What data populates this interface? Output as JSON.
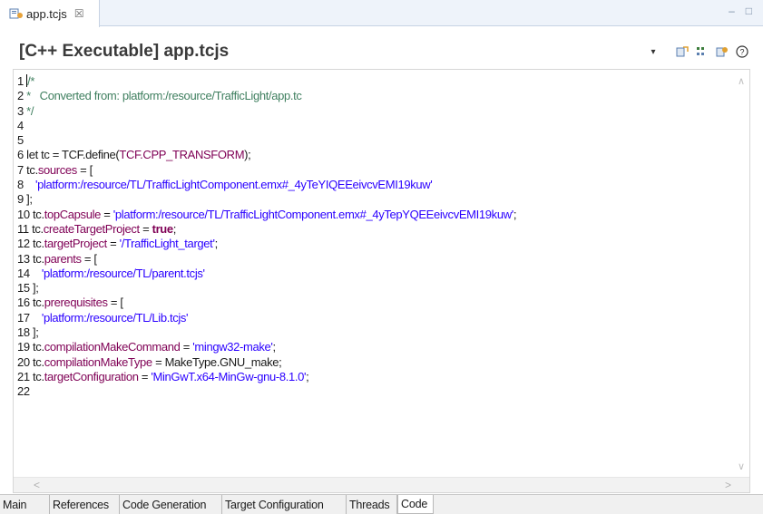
{
  "editor_tab": {
    "title": "app.tcjs",
    "close": "☒"
  },
  "window_controls": {
    "minimize": "–",
    "maximize": "□"
  },
  "header": {
    "title": "[C++ Executable] app.tcjs"
  },
  "toolbar": {
    "menu": "▾",
    "help": "?"
  },
  "code_lines": [
    [
      {
        "t": "ln",
        "v": "1 "
      },
      {
        "t": "cursor",
        "v": ""
      },
      {
        "t": "cm",
        "v": "/*"
      }
    ],
    [
      {
        "t": "ln",
        "v": "2 "
      },
      {
        "t": "cm",
        "v": "*   Converted from: platform:/resource/TrafficLight/app.tc"
      }
    ],
    [
      {
        "t": "ln",
        "v": "3 "
      },
      {
        "t": "cm",
        "v": "*/"
      }
    ],
    [
      {
        "t": "ln",
        "v": "4"
      }
    ],
    [
      {
        "t": "ln",
        "v": "5"
      }
    ],
    [
      {
        "t": "ln",
        "v": "6 "
      },
      {
        "t": "p",
        "v": "let tc = TCF.define("
      },
      {
        "t": "pr",
        "v": "TCF.CPP_TRANSFORM"
      },
      {
        "t": "p",
        "v": ");"
      }
    ],
    [
      {
        "t": "ln",
        "v": "7 "
      },
      {
        "t": "p",
        "v": "tc."
      },
      {
        "t": "pr",
        "v": "sources"
      },
      {
        "t": "p",
        "v": " = ["
      }
    ],
    [
      {
        "t": "ln",
        "v": "8    "
      },
      {
        "t": "st",
        "v": "'platform:/resource/TL/TrafficLightComponent.emx#_4yTeYIQEEeivcvEMI19kuw'"
      }
    ],
    [
      {
        "t": "ln",
        "v": "9 "
      },
      {
        "t": "p",
        "v": "];"
      }
    ],
    [
      {
        "t": "ln",
        "v": "10 "
      },
      {
        "t": "p",
        "v": "tc."
      },
      {
        "t": "pr",
        "v": "topCapsule"
      },
      {
        "t": "p",
        "v": " = "
      },
      {
        "t": "st",
        "v": "'platform:/resource/TL/TrafficLightComponent.emx#_4yTepYQEEeivcvEMI19kuw'"
      },
      {
        "t": "p",
        "v": ";"
      }
    ],
    [
      {
        "t": "ln",
        "v": "11 "
      },
      {
        "t": "p",
        "v": "tc."
      },
      {
        "t": "pr",
        "v": "createTargetProject"
      },
      {
        "t": "p",
        "v": " = "
      },
      {
        "t": "kw",
        "v": "true"
      },
      {
        "t": "p",
        "v": ";"
      }
    ],
    [
      {
        "t": "ln",
        "v": "12 "
      },
      {
        "t": "p",
        "v": "tc."
      },
      {
        "t": "pr",
        "v": "targetProject"
      },
      {
        "t": "p",
        "v": " = "
      },
      {
        "t": "st",
        "v": "'/TrafficLight_target'"
      },
      {
        "t": "p",
        "v": ";"
      }
    ],
    [
      {
        "t": "ln",
        "v": "13 "
      },
      {
        "t": "p",
        "v": "tc."
      },
      {
        "t": "pr",
        "v": "parents"
      },
      {
        "t": "p",
        "v": " = ["
      }
    ],
    [
      {
        "t": "ln",
        "v": "14    "
      },
      {
        "t": "st",
        "v": "'platform:/resource/TL/parent.tcjs'"
      }
    ],
    [
      {
        "t": "ln",
        "v": "15 "
      },
      {
        "t": "p",
        "v": "];"
      }
    ],
    [
      {
        "t": "ln",
        "v": "16 "
      },
      {
        "t": "p",
        "v": "tc."
      },
      {
        "t": "pr",
        "v": "prerequisites"
      },
      {
        "t": "p",
        "v": " = ["
      }
    ],
    [
      {
        "t": "ln",
        "v": "17    "
      },
      {
        "t": "st",
        "v": "'platform:/resource/TL/Lib.tcjs'"
      }
    ],
    [
      {
        "t": "ln",
        "v": "18 "
      },
      {
        "t": "p",
        "v": "];"
      }
    ],
    [
      {
        "t": "ln",
        "v": "19 "
      },
      {
        "t": "p",
        "v": "tc."
      },
      {
        "t": "pr",
        "v": "compilationMakeCommand"
      },
      {
        "t": "p",
        "v": " = "
      },
      {
        "t": "st",
        "v": "'mingw32-make'"
      },
      {
        "t": "p",
        "v": ";"
      }
    ],
    [
      {
        "t": "ln",
        "v": "20 "
      },
      {
        "t": "p",
        "v": "tc."
      },
      {
        "t": "pr",
        "v": "compilationMakeType"
      },
      {
        "t": "p",
        "v": " = MakeType.GNU_make;"
      }
    ],
    [
      {
        "t": "ln",
        "v": "21 "
      },
      {
        "t": "p",
        "v": "tc."
      },
      {
        "t": "pr",
        "v": "targetConfiguration"
      },
      {
        "t": "p",
        "v": " = "
      },
      {
        "t": "st",
        "v": "'MinGwT.x64-MinGw-gnu-8.1.0'"
      },
      {
        "t": "p",
        "v": ";"
      }
    ],
    [
      {
        "t": "ln",
        "v": "22"
      }
    ]
  ],
  "scrollbars": {
    "up": "∧",
    "down": "∨",
    "left": "<",
    "right": ">"
  },
  "page_tabs": [
    {
      "label": "Main",
      "active": false
    },
    {
      "label": "References",
      "active": false
    },
    {
      "label": "Code Generation",
      "active": false
    },
    {
      "label": "Target Configuration",
      "active": false
    },
    {
      "label": "Threads",
      "active": false
    },
    {
      "label": "Code",
      "active": true
    }
  ],
  "colors": {
    "comment": "#3f7f5f",
    "string": "#2a00ff",
    "property": "#7f0055",
    "keyword": "#7f0055"
  }
}
